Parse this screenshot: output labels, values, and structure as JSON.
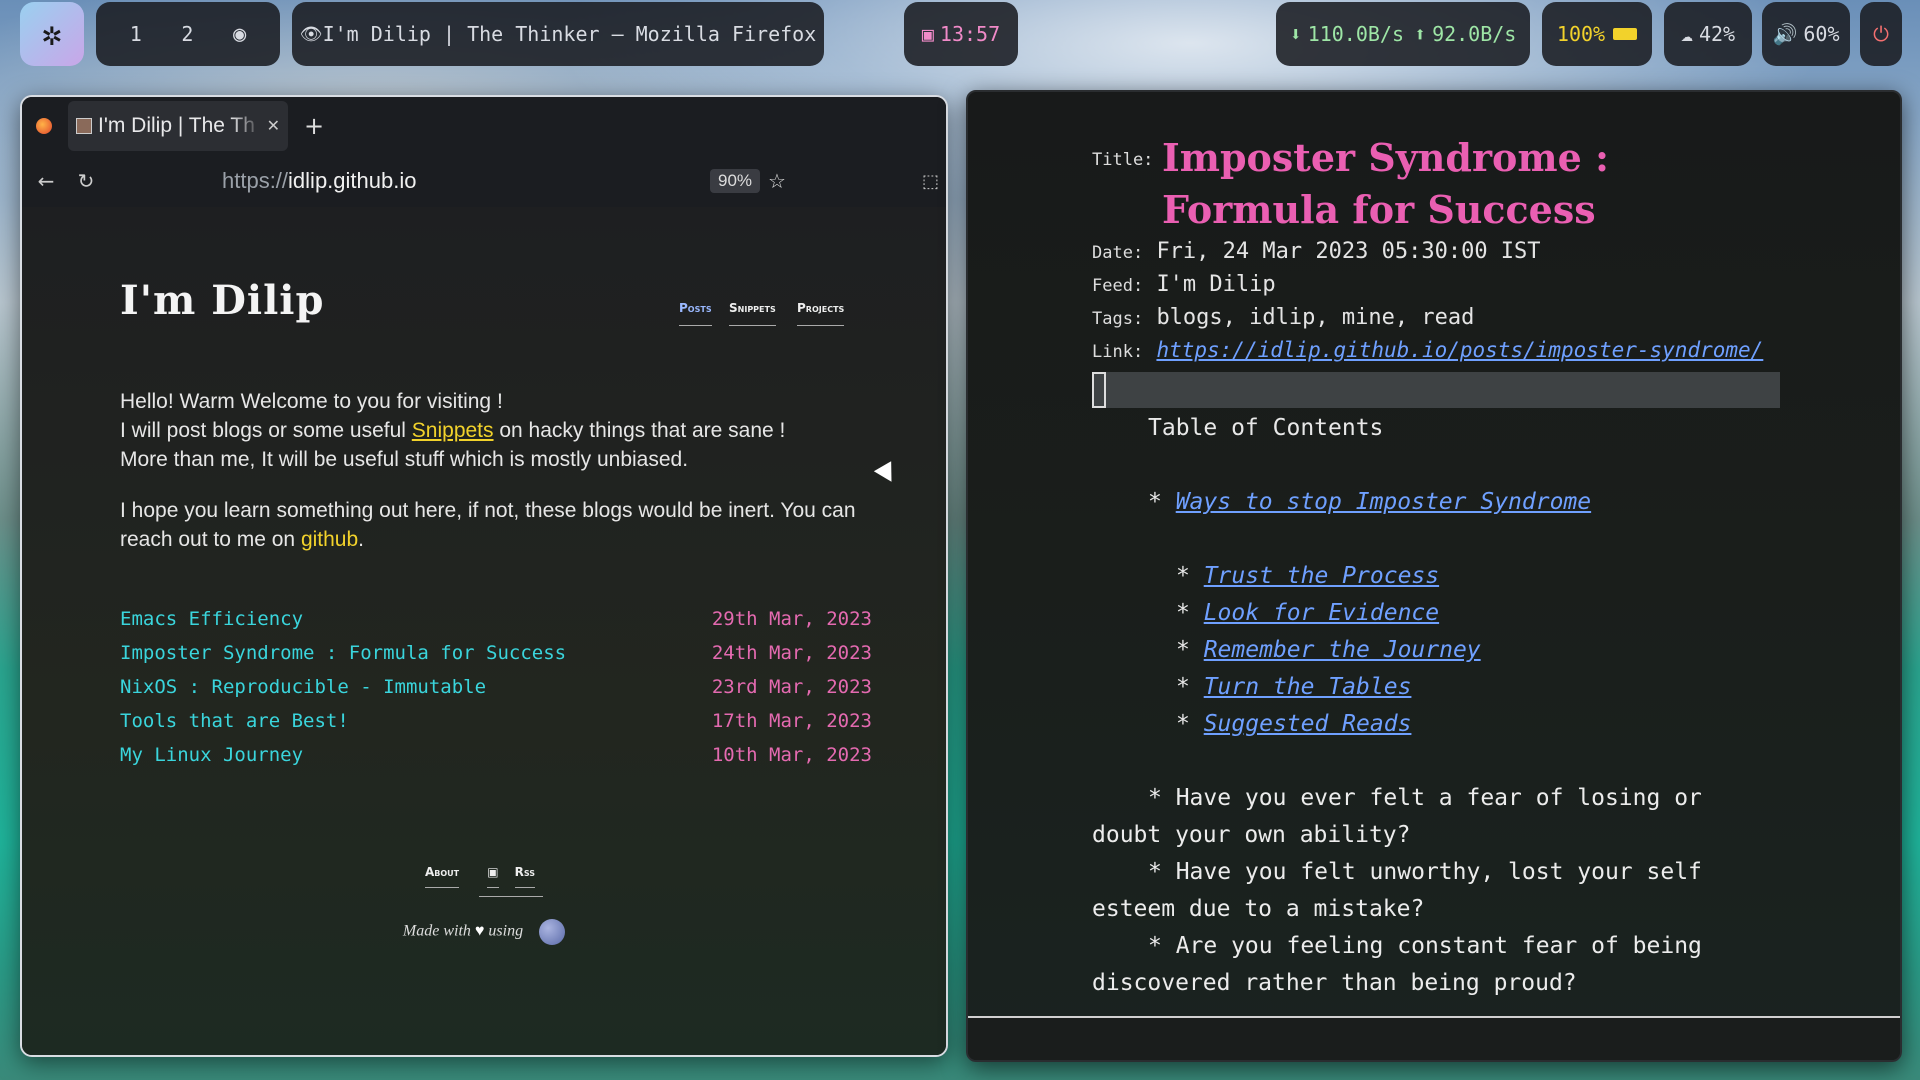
{
  "topbar": {
    "workspaces": [
      "1",
      "2"
    ],
    "window_title": "I'm Dilip | The Thinker — Mozilla Firefox",
    "clock": "13:57",
    "net_down": "110.0B/s",
    "net_up": "92.0B/s",
    "battery": "100%",
    "brightness": "42%",
    "volume": "60%"
  },
  "firefox": {
    "tab_label": "I'm Dilip | The Th",
    "new_tab": "+",
    "url_proto": "https://",
    "url_host": "idlip.github.io",
    "zoom": "90%"
  },
  "site": {
    "title": "I'm Dilip",
    "nav": [
      "Posts",
      "Snippets",
      "Projects"
    ],
    "intro": {
      "p1_l1": "Hello! Warm Welcome to you for visiting !",
      "p1_l2_a": "I will post blogs or some useful ",
      "p1_l2_link": "Snippets",
      "p1_l2_b": " on hacky things that are sane !",
      "p1_l3": "More than me, It will be useful stuff which is mostly unbiased.",
      "p2_a": "I hope you learn something out here, if not, these blogs would be inert. You can reach out to me on ",
      "p2_link": "github",
      "p2_b": "."
    },
    "posts": [
      {
        "title": "Emacs Efficiency",
        "date": "29th Mar, 2023"
      },
      {
        "title": "Imposter Syndrome : Formula for Success",
        "date": "24th Mar, 2023"
      },
      {
        "title": "NixOS : Reproducible - Immutable",
        "date": "23rd Mar, 2023"
      },
      {
        "title": "Tools that are Best!",
        "date": "17th Mar, 2023"
      },
      {
        "title": "My Linux Journey",
        "date": "10th Mar, 2023"
      }
    ],
    "footer_links": [
      "About",
      "Rss"
    ],
    "made_a": "Made with ",
    "made_b": " using"
  },
  "reader": {
    "labels": {
      "title": "Title:",
      "date": "Date:",
      "feed": "Feed:",
      "tags": "Tags:",
      "link": "Link:"
    },
    "title": "Imposter Syndrome : Formula for Success",
    "date": "Fri, 24 Mar 2023 05:30:00 IST",
    "feed": "I'm Dilip",
    "tags": "blogs, idlip, mine, read",
    "link": "https://idlip.github.io/posts/imposter-syndrome/",
    "toc_heading": "Table of Contents",
    "toc_top": "Ways to stop Imposter Syndrome",
    "toc_sub": [
      "Trust the Process",
      "Look for Evidence",
      "Remember the Journey",
      "Turn the Tables",
      "Suggested Reads"
    ],
    "bullets": [
      {
        "l1": "* Have you ever felt a fear of losing or",
        "l2": "doubt your own ability?"
      },
      {
        "l1": "* Have you felt unworthy, lost your self",
        "l2": "esteem due to a mistake?"
      },
      {
        "l1": "* Are you feeling constant fear of being",
        "l2": "discovered rather than being proud?"
      }
    ]
  }
}
